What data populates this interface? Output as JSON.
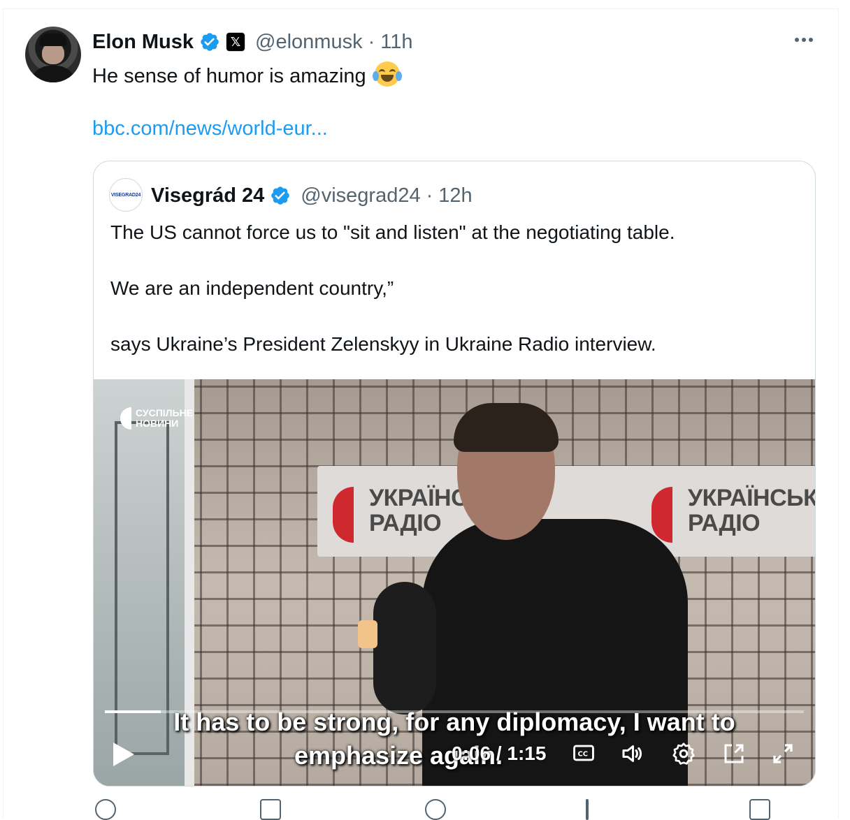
{
  "author": {
    "name": "Elon Musk",
    "handle": "@elonmusk",
    "time_sep": "·",
    "time": "11h",
    "verified_icon": "verified-badge-icon",
    "affiliate_icon": "x-logo-icon"
  },
  "tweet": {
    "text": "He sense of humor is amazing",
    "emoji": "face-with-tears-of-joy-emoji",
    "link": "bbc.com/news/world-eur..."
  },
  "quoted": {
    "avatar_text": "VISEGRAD24",
    "name": "Visegrád 24",
    "handle": "@visegrad24",
    "time_sep": "·",
    "time": "12h",
    "lines": [
      "The US cannot force us to \"sit and listen\" at the negotiating table.",
      "We are an independent country,”",
      "says Ukraine’s President Zelenskyy in Ukraine Radio interview."
    ]
  },
  "video": {
    "watermark": [
      "СУСПІЛЬНЕ",
      "НОВИНИ"
    ],
    "sign_left": [
      "УКРАЇНСЬК",
      "РАДІО"
    ],
    "sign_right": [
      "УКРАЇНСЬКЕ",
      "РАДІО"
    ],
    "subtitle_line1": "It has to be strong, for any diplomacy, I want to",
    "subtitle_line2": "emphasize again.",
    "time_display": "0:06 / 1:15",
    "progress_fraction": 0.08,
    "controls": [
      "play-icon",
      "captions-icon",
      "volume-icon",
      "settings-icon",
      "pip-icon",
      "fullscreen-icon"
    ]
  },
  "colors": {
    "accent": "#1d9bf0",
    "text": "#0f1419",
    "secondary": "#536471",
    "border": "#cfd9de"
  }
}
